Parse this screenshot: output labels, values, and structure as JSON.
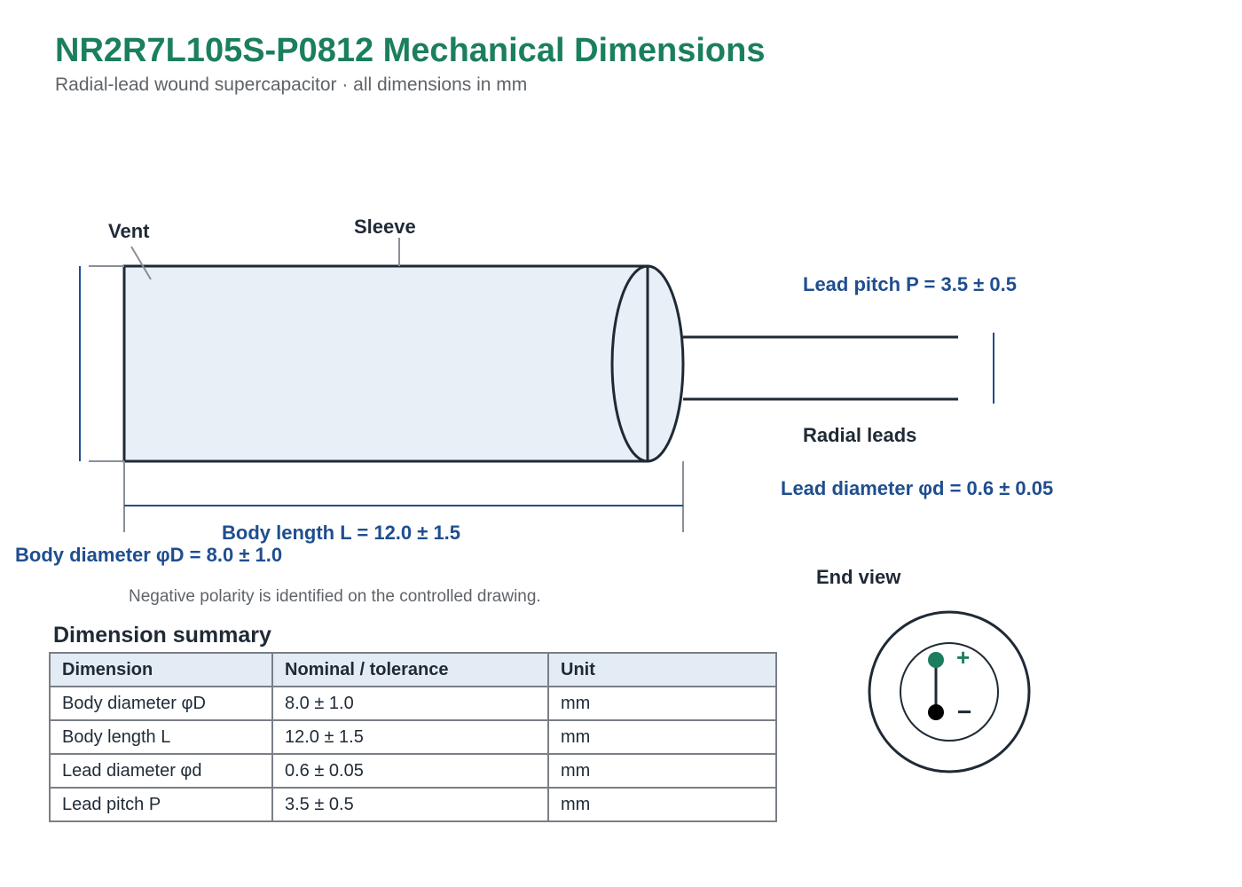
{
  "header": {
    "title": "NR2R7L105S-P0812 Mechanical Dimensions",
    "subtitle": "Radial-lead wound supercapacitor · all dimensions in mm"
  },
  "drawing": {
    "labels": {
      "vent": "Vent",
      "sleeve": "Sleeve",
      "radial_leads": "Radial leads",
      "end_view": "End view"
    },
    "dimensions": {
      "lead_pitch": "Lead pitch P = 3.5 ± 0.5",
      "lead_diameter": "Lead diameter φd = 0.6 ± 0.05",
      "body_length": "Body length L = 12.0 ± 1.5",
      "body_diameter": "Body diameter φD = 8.0 ± 1.0"
    },
    "note": "Negative polarity is identified on the controlled drawing.",
    "polarity": {
      "plus": "+",
      "minus": "−"
    },
    "colors": {
      "body_fill": "#e8eff7",
      "outline": "#1f2a36",
      "dimension": "#1f4e8f",
      "positive": "#1b7f5f"
    }
  },
  "summary": {
    "heading": "Dimension summary",
    "columns": [
      "Dimension",
      "Nominal / tolerance",
      "Unit"
    ],
    "rows": [
      [
        "Body diameter φD",
        "8.0 ± 1.0",
        "mm"
      ],
      [
        "Body length L",
        "12.0 ± 1.5",
        "mm"
      ],
      [
        "Lead diameter φd",
        "0.6 ± 0.05",
        "mm"
      ],
      [
        "Lead pitch P",
        "3.5 ± 0.5",
        "mm"
      ]
    ]
  }
}
